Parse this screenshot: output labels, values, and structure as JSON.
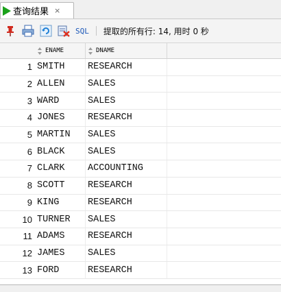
{
  "tab": {
    "label": "查询结果",
    "close": "×"
  },
  "toolbar": {
    "sql_label": "SQL",
    "status_text": "提取的所有行: 14, 用时 0 秒"
  },
  "grid": {
    "columns": [
      "ENAME",
      "DNAME"
    ],
    "rows": [
      {
        "n": "1",
        "ename": "SMITH",
        "dname": "RESEARCH"
      },
      {
        "n": "2",
        "ename": "ALLEN",
        "dname": "SALES"
      },
      {
        "n": "3",
        "ename": "WARD",
        "dname": "SALES"
      },
      {
        "n": "4",
        "ename": "JONES",
        "dname": "RESEARCH"
      },
      {
        "n": "5",
        "ename": "MARTIN",
        "dname": "SALES"
      },
      {
        "n": "6",
        "ename": "BLACK",
        "dname": "SALES"
      },
      {
        "n": "7",
        "ename": "CLARK",
        "dname": "ACCOUNTING"
      },
      {
        "n": "8",
        "ename": "SCOTT",
        "dname": "RESEARCH"
      },
      {
        "n": "9",
        "ename": "KING",
        "dname": "RESEARCH"
      },
      {
        "n": "10",
        "ename": "TURNER",
        "dname": "SALES"
      },
      {
        "n": "11",
        "ename": "ADAMS",
        "dname": "RESEARCH"
      },
      {
        "n": "12",
        "ename": "JAMES",
        "dname": "SALES"
      },
      {
        "n": "13",
        "ename": "FORD",
        "dname": "RESEARCH"
      }
    ]
  },
  "colors": {
    "tab_play": "#1aa11a",
    "sql_link": "#1b57b8"
  },
  "icons": [
    "play-icon",
    "pin-icon",
    "print-icon",
    "refresh-icon",
    "export-icon"
  ]
}
